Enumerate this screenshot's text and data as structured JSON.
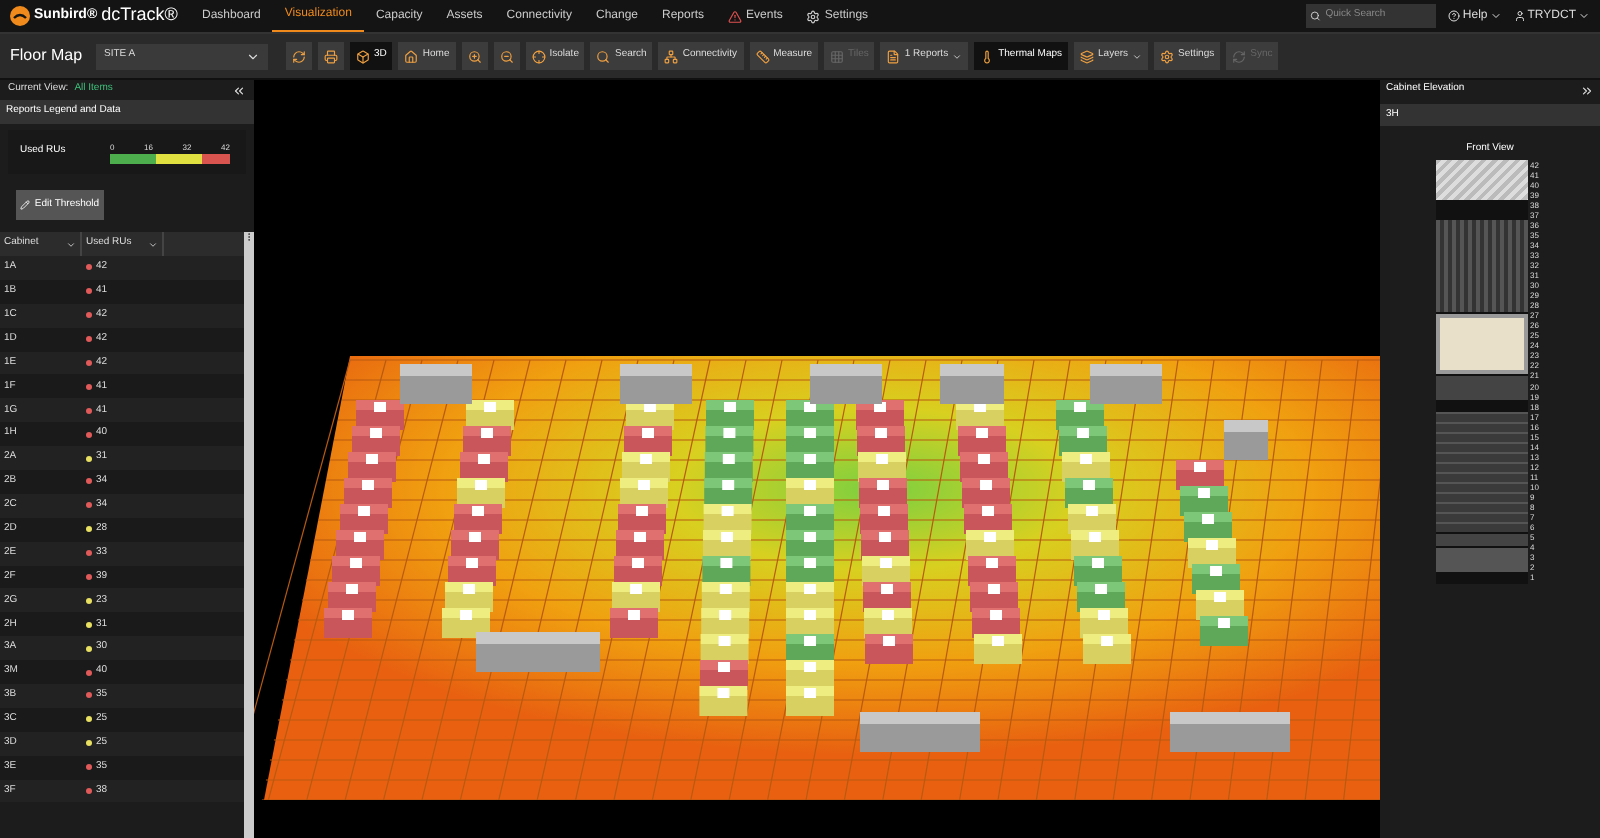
{
  "header": {
    "logo": {
      "brand": "Sunbird®",
      "product": "dcTrack®"
    },
    "nav": [
      {
        "label": "Dashboard",
        "selected": false
      },
      {
        "label": "Visualization",
        "selected": true
      },
      {
        "label": "Capacity",
        "selected": false
      },
      {
        "label": "Assets",
        "selected": false
      },
      {
        "label": "Connectivity",
        "selected": false
      },
      {
        "label": "Change",
        "selected": false
      },
      {
        "label": "Reports",
        "selected": false
      },
      {
        "label": "Events",
        "selected": false
      },
      {
        "label": "Settings",
        "selected": false
      }
    ],
    "search": {
      "placeholder": "Quick Search"
    },
    "help": "Help",
    "user": "TRYDCT"
  },
  "toolbar": {
    "title": "Floor Map",
    "site": "SITE A",
    "items": [
      {
        "selected": false,
        "disabled": false,
        "dropdown": false
      },
      {
        "selected": false,
        "disabled": false,
        "dropdown": false
      },
      {
        "label": "3D",
        "selected": true,
        "disabled": false,
        "dropdown": false
      },
      {
        "label": "Home",
        "selected": false,
        "disabled": false,
        "dropdown": false
      },
      {
        "selected": false,
        "disabled": false,
        "dropdown": false
      },
      {
        "selected": false,
        "disabled": false,
        "dropdown": false
      },
      {
        "label": "Isolate",
        "selected": false,
        "disabled": false,
        "dropdown": false
      },
      {
        "label": "Search",
        "selected": false,
        "disabled": false,
        "dropdown": false
      },
      {
        "label": "Connectivity",
        "selected": false,
        "disabled": false,
        "dropdown": false
      },
      {
        "label": "Measure",
        "selected": false,
        "disabled": false,
        "dropdown": false
      },
      {
        "label": "Tiles",
        "selected": false,
        "disabled": true,
        "dropdown": false
      },
      {
        "label": "1 Reports",
        "selected": false,
        "disabled": false,
        "dropdown": true
      },
      {
        "label": "Thermal Maps",
        "selected": true,
        "disabled": false,
        "dropdown": false
      },
      {
        "label": "Layers",
        "selected": false,
        "disabled": false,
        "dropdown": true
      },
      {
        "label": "Settings",
        "selected": false,
        "disabled": false,
        "dropdown": false
      },
      {
        "label": "Sync",
        "selected": false,
        "disabled": true,
        "dropdown": false
      }
    ]
  },
  "left_panel": {
    "current_view_label": "Current View:",
    "current_view": "All Items",
    "section_title": "Reports Legend and Data",
    "legend": {
      "label": "Used RUs",
      "ticks": [
        "0",
        "16",
        "32",
        "42"
      ]
    },
    "edit_button": "Edit Threshold",
    "table": {
      "columns": [
        "Cabinet",
        "Used RUs"
      ],
      "rows": [
        {
          "cabinet": "1A",
          "value": "42",
          "color": "#e05a5a"
        },
        {
          "cabinet": "1B",
          "value": "41",
          "color": "#e05a5a"
        },
        {
          "cabinet": "1C",
          "value": "42",
          "color": "#e05a5a"
        },
        {
          "cabinet": "1D",
          "value": "42",
          "color": "#e05a5a"
        },
        {
          "cabinet": "1E",
          "value": "42",
          "color": "#e05a5a"
        },
        {
          "cabinet": "1F",
          "value": "41",
          "color": "#e05a5a"
        },
        {
          "cabinet": "1G",
          "value": "41",
          "color": "#e05a5a"
        },
        {
          "cabinet": "1H",
          "value": "40",
          "color": "#e05a5a"
        },
        {
          "cabinet": "2A",
          "value": "31",
          "color": "#e8e060"
        },
        {
          "cabinet": "2B",
          "value": "34",
          "color": "#e05a5a"
        },
        {
          "cabinet": "2C",
          "value": "34",
          "color": "#e05a5a"
        },
        {
          "cabinet": "2D",
          "value": "28",
          "color": "#e8e060"
        },
        {
          "cabinet": "2E",
          "value": "33",
          "color": "#e05a5a"
        },
        {
          "cabinet": "2F",
          "value": "39",
          "color": "#e05a5a"
        },
        {
          "cabinet": "2G",
          "value": "23",
          "color": "#e8e060"
        },
        {
          "cabinet": "2H",
          "value": "31",
          "color": "#e8e060"
        },
        {
          "cabinet": "3A",
          "value": "30",
          "color": "#e8e060"
        },
        {
          "cabinet": "3M",
          "value": "40",
          "color": "#e05a5a"
        },
        {
          "cabinet": "3B",
          "value": "35",
          "color": "#e05a5a"
        },
        {
          "cabinet": "3C",
          "value": "25",
          "color": "#e8e060"
        },
        {
          "cabinet": "3D",
          "value": "25",
          "color": "#e8e060"
        },
        {
          "cabinet": "3E",
          "value": "35",
          "color": "#e05a5a"
        },
        {
          "cabinet": "3F",
          "value": "38",
          "color": "#e05a5a"
        }
      ]
    }
  },
  "right_panel": {
    "title": "Cabinet Elevation",
    "cabinet": "3H",
    "view": "Front View",
    "units": [
      "42",
      "41",
      "40",
      "39",
      "38",
      "37",
      "36",
      "35",
      "34",
      "33",
      "32",
      "31",
      "30",
      "29",
      "28",
      "27",
      "26",
      "25",
      "24",
      "23",
      "22",
      "21",
      "20",
      "19",
      "18",
      "17",
      "16",
      "15",
      "14",
      "13",
      "12",
      "11",
      "10",
      "9",
      "8",
      "7",
      "6",
      "5",
      "4",
      "3",
      "2",
      "1"
    ]
  }
}
